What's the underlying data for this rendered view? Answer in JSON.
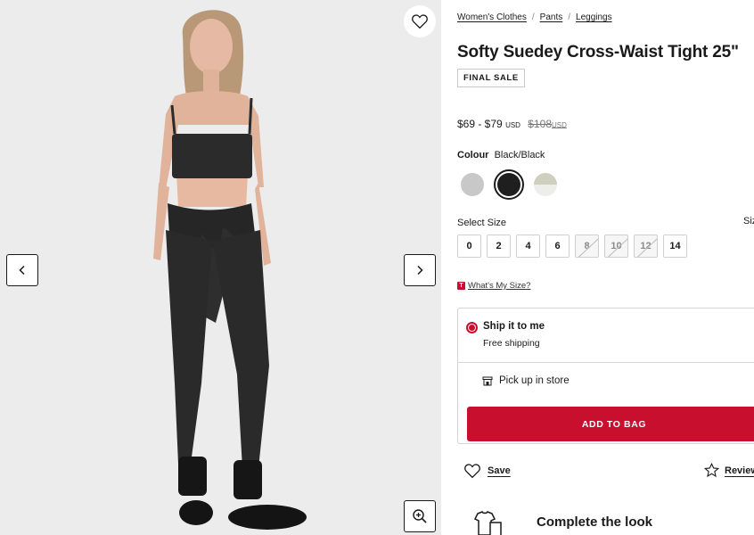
{
  "gallery": {
    "wishlist_icon": "heart-icon",
    "prev_icon": "chevron-left-icon",
    "next_icon": "chevron-right-icon",
    "zoom_icon": "zoom-in-icon",
    "background": "#ececec"
  },
  "breadcrumb": [
    "Women's Clothes",
    "Pants",
    "Leggings"
  ],
  "product": {
    "title": "Softy Suedey Cross-Waist Tight 25\"",
    "badge": "FINAL SALE",
    "price_range": "$69 - $79",
    "currency": "USD",
    "original_price": "$108",
    "original_currency": "USD"
  },
  "colour": {
    "label": "Colour",
    "value": "Black/Black",
    "swatches": [
      {
        "name": "light-grey",
        "color": "#c8c8c8",
        "selected": false
      },
      {
        "name": "black",
        "color": "#1f1f1f",
        "selected": true
      },
      {
        "name": "sage-white",
        "color": "#d3d3c4",
        "selected": false
      }
    ]
  },
  "size": {
    "label": "Select Size",
    "guide_label": "Siz",
    "options": [
      {
        "label": "0",
        "available": true
      },
      {
        "label": "2",
        "available": true
      },
      {
        "label": "4",
        "available": true
      },
      {
        "label": "6",
        "available": true
      },
      {
        "label": "8",
        "available": false
      },
      {
        "label": "10",
        "available": false
      },
      {
        "label": "12",
        "available": false
      },
      {
        "label": "14",
        "available": true
      }
    ],
    "whats_my_size": "What's My Size?"
  },
  "fulfillment": {
    "ship_title": "Ship it to me",
    "ship_sub": "Free shipping",
    "pickup": "Pick up in store",
    "add_to_bag": "ADD TO BAG",
    "accent": "#c8102e"
  },
  "actions": {
    "save": "Save",
    "reviews": "Review"
  },
  "complete_look": {
    "title": "Complete the look"
  }
}
